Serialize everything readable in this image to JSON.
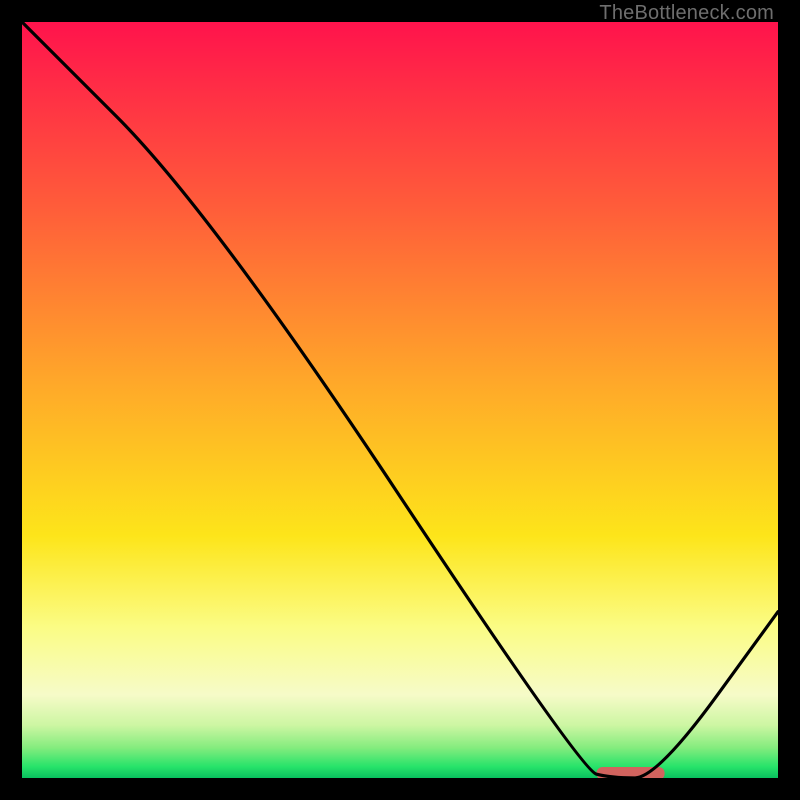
{
  "watermark": "TheBottleneck.com",
  "chart_data": {
    "type": "line",
    "title": "",
    "xlabel": "",
    "ylabel": "",
    "xlim": [
      0,
      100
    ],
    "ylim": [
      0,
      100
    ],
    "series": [
      {
        "name": "curve",
        "x": [
          0,
          25,
          74,
          78,
          84,
          100
        ],
        "y": [
          100,
          75,
          1,
          0,
          0,
          22
        ]
      }
    ],
    "marker": {
      "name": "optimum-bar",
      "x_start": 76,
      "x_end": 85,
      "y": 0,
      "color": "#d1635e"
    },
    "gradient_stops": [
      {
        "pct": 0,
        "color": "#ff134c"
      },
      {
        "pct": 24,
        "color": "#ff5b3a"
      },
      {
        "pct": 48,
        "color": "#ffa929"
      },
      {
        "pct": 68,
        "color": "#fde51a"
      },
      {
        "pct": 80,
        "color": "#fbfc84"
      },
      {
        "pct": 89,
        "color": "#f6fbc8"
      },
      {
        "pct": 93,
        "color": "#cdf6a3"
      },
      {
        "pct": 96,
        "color": "#84ec7e"
      },
      {
        "pct": 98.5,
        "color": "#27e36a"
      },
      {
        "pct": 100,
        "color": "#09c05f"
      }
    ]
  }
}
